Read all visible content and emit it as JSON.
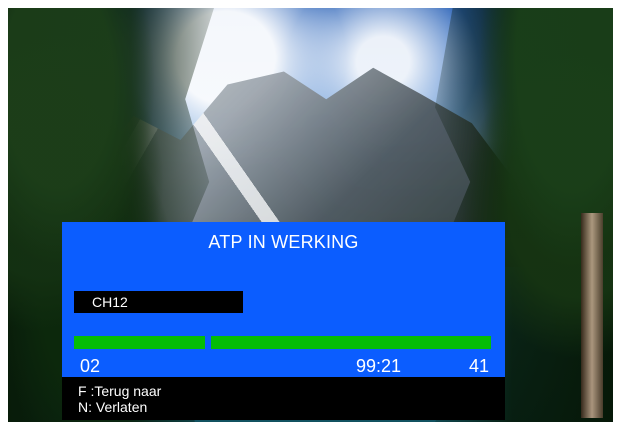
{
  "scene": {
    "background_image": "mountain lake landscape"
  },
  "osd": {
    "title": "ATP IN WERKING",
    "channel": "CH12",
    "progress": {
      "left_segment": 1.0,
      "right_segment": 1.0,
      "color": "#05bd05"
    },
    "status": {
      "left": "02",
      "time": "99:21",
      "right": "41"
    },
    "colors": {
      "panel": "#0b5dff",
      "channel_box": "#000000",
      "help_panel": "#000000",
      "text": "#ffffff"
    }
  },
  "help": {
    "line1": "F :Terug naar",
    "line2": "N: Verlaten"
  }
}
